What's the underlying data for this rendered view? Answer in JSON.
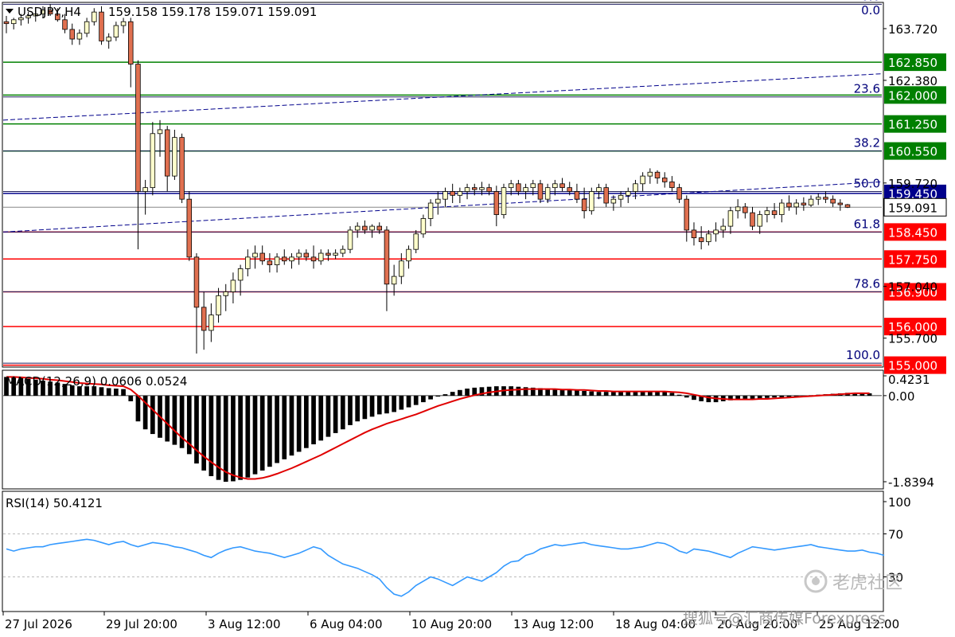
{
  "header": {
    "symbol_title": "USDJPY,H4",
    "ohlc": "159.158 159.178 159.071 159.091"
  },
  "colors": {
    "bull_candle": "#ffffcc",
    "bear_candle": "#e07050",
    "green_level": "#008000",
    "red_level": "#ff0000",
    "fib_line": "#1f1f5f",
    "trend_dash": "#00008b",
    "macd_signal": "#e00000",
    "rsi_line": "#3399ff"
  },
  "price_axis": {
    "ticks": [
      "163.720",
      "162.380",
      "159.720",
      "157.040",
      "155.700"
    ]
  },
  "levels": [
    {
      "price": 162.85,
      "label": "162.850",
      "color": "green"
    },
    {
      "price": 162.0,
      "label": "162.000",
      "color": "green"
    },
    {
      "price": 161.25,
      "label": "161.250",
      "color": "green"
    },
    {
      "price": 160.55,
      "label": "160.550",
      "color": "green"
    },
    {
      "price": 159.45,
      "label": "159.450",
      "color": "blue"
    },
    {
      "price": 158.45,
      "label": "158.450",
      "color": "red"
    },
    {
      "price": 157.75,
      "label": "157.750",
      "color": "red"
    },
    {
      "price": 156.9,
      "label": "156.900",
      "color": "red"
    },
    {
      "price": 156.0,
      "label": "156.000",
      "color": "red"
    },
    {
      "price": 155.0,
      "label": "155.000",
      "color": "red"
    }
  ],
  "fibonacci": [
    {
      "level": "0.0",
      "price": 164.35
    },
    {
      "level": "23.6",
      "price": 161.95
    },
    {
      "level": "38.2",
      "price": 160.55
    },
    {
      "level": "50.0",
      "price": 159.5
    },
    {
      "level": "61.8",
      "price": 158.45
    },
    {
      "level": "78.6",
      "price": 156.9
    },
    {
      "level": "100.0",
      "price": 155.05
    }
  ],
  "current_price": "159.091",
  "macd": {
    "label": "MACD(12,26,9) 0.0606 0.0524",
    "ticks": [
      "0.4231",
      "0.00",
      "-1.8394"
    ]
  },
  "rsi": {
    "label": "RSI(14) 50.4121",
    "ticks": [
      "100",
      "70",
      "30"
    ]
  },
  "time_axis": {
    "labels": [
      "27 Jul 2026",
      "29 Jul 20:00",
      "3 Aug 12:00",
      "6 Aug 04:00",
      "10 Aug 20:00",
      "13 Aug 12:00",
      "18 Aug 04:00",
      "20 Aug 20:00",
      "25 Aug 12:00"
    ]
  },
  "watermarks": {
    "top": "老虎社区",
    "bottom": "搜狐号@汇商传媒Forexpress"
  },
  "chart_data": {
    "type": "candlestick",
    "title": "USDJPY,H4",
    "ylim": [
      154.95,
      164.4
    ],
    "candles_ohlc": [
      [
        163.9,
        164.05,
        163.6,
        163.85
      ],
      [
        163.85,
        164.0,
        163.7,
        163.95
      ],
      [
        163.95,
        164.1,
        163.8,
        164.0
      ],
      [
        164.0,
        164.15,
        163.85,
        164.05
      ],
      [
        164.05,
        164.2,
        163.9,
        164.1
      ],
      [
        164.1,
        164.3,
        164.0,
        164.2
      ],
      [
        164.2,
        164.35,
        164.05,
        164.1
      ],
      [
        164.1,
        164.25,
        163.9,
        163.95
      ],
      [
        163.95,
        164.1,
        163.6,
        163.7
      ],
      [
        163.7,
        163.85,
        163.3,
        163.45
      ],
      [
        163.45,
        163.7,
        163.3,
        163.6
      ],
      [
        163.6,
        164.0,
        163.5,
        163.9
      ],
      [
        163.9,
        164.25,
        163.8,
        164.15
      ],
      [
        164.15,
        164.3,
        163.3,
        163.4
      ],
      [
        163.4,
        163.6,
        163.2,
        163.5
      ],
      [
        163.5,
        163.9,
        163.4,
        163.8
      ],
      [
        163.8,
        164.0,
        163.6,
        163.9
      ],
      [
        163.9,
        164.0,
        162.2,
        162.8
      ],
      [
        162.8,
        162.9,
        158.0,
        159.5
      ],
      [
        159.5,
        159.8,
        158.9,
        159.6
      ],
      [
        159.6,
        161.3,
        159.4,
        161.0
      ],
      [
        161.0,
        161.35,
        160.4,
        161.1
      ],
      [
        161.1,
        161.2,
        159.5,
        159.9
      ],
      [
        159.9,
        161.1,
        159.8,
        160.9
      ],
      [
        160.9,
        161.0,
        159.2,
        159.3
      ],
      [
        159.3,
        159.5,
        157.7,
        157.8
      ],
      [
        157.8,
        157.9,
        155.3,
        156.5
      ],
      [
        156.5,
        156.9,
        155.4,
        155.9
      ],
      [
        155.9,
        156.6,
        155.6,
        156.3
      ],
      [
        156.3,
        157.0,
        156.1,
        156.8
      ],
      [
        156.8,
        157.1,
        156.4,
        156.9
      ],
      [
        156.9,
        157.4,
        156.6,
        157.2
      ],
      [
        157.2,
        157.6,
        156.8,
        157.5
      ],
      [
        157.5,
        158.0,
        157.3,
        157.8
      ],
      [
        157.8,
        158.1,
        157.5,
        157.9
      ],
      [
        157.9,
        158.1,
        157.6,
        157.7
      ],
      [
        157.7,
        157.9,
        157.4,
        157.6
      ],
      [
        157.6,
        157.9,
        157.4,
        157.8
      ],
      [
        157.8,
        158.0,
        157.6,
        157.7
      ],
      [
        157.7,
        157.9,
        157.5,
        157.8
      ],
      [
        157.8,
        158.0,
        157.6,
        157.9
      ],
      [
        157.9,
        158.0,
        157.7,
        157.8
      ],
      [
        157.8,
        158.1,
        157.5,
        157.7
      ],
      [
        157.7,
        158.0,
        157.6,
        157.9
      ],
      [
        157.9,
        158.0,
        157.7,
        157.85
      ],
      [
        157.85,
        158.0,
        157.75,
        157.9
      ],
      [
        157.9,
        158.1,
        157.8,
        158.0
      ],
      [
        158.0,
        158.6,
        157.9,
        158.5
      ],
      [
        158.5,
        158.7,
        158.3,
        158.6
      ],
      [
        158.6,
        158.75,
        158.4,
        158.5
      ],
      [
        158.5,
        158.65,
        158.3,
        158.6
      ],
      [
        158.6,
        158.7,
        158.4,
        158.5
      ],
      [
        158.5,
        158.6,
        156.4,
        157.1
      ],
      [
        157.1,
        157.6,
        156.8,
        157.3
      ],
      [
        157.3,
        157.9,
        157.1,
        157.7
      ],
      [
        157.7,
        158.1,
        157.5,
        158.0
      ],
      [
        158.0,
        158.5,
        157.9,
        158.4
      ],
      [
        158.4,
        158.9,
        158.3,
        158.8
      ],
      [
        158.8,
        159.3,
        158.6,
        159.2
      ],
      [
        159.2,
        159.5,
        158.9,
        159.3
      ],
      [
        159.3,
        159.6,
        159.1,
        159.5
      ],
      [
        159.5,
        159.7,
        159.2,
        159.4
      ],
      [
        159.4,
        159.6,
        159.2,
        159.5
      ],
      [
        159.5,
        159.7,
        159.3,
        159.6
      ],
      [
        159.6,
        159.7,
        159.4,
        159.55
      ],
      [
        159.55,
        159.75,
        159.4,
        159.6
      ],
      [
        159.6,
        159.7,
        159.4,
        159.5
      ],
      [
        159.5,
        159.65,
        158.6,
        158.9
      ],
      [
        158.9,
        159.7,
        158.8,
        159.6
      ],
      [
        159.6,
        159.8,
        159.4,
        159.7
      ],
      [
        159.7,
        159.8,
        159.4,
        159.5
      ],
      [
        159.5,
        159.7,
        159.3,
        159.6
      ],
      [
        159.6,
        159.8,
        159.4,
        159.7
      ],
      [
        159.7,
        159.8,
        159.2,
        159.3
      ],
      [
        159.3,
        159.7,
        159.2,
        159.6
      ],
      [
        159.6,
        159.8,
        159.4,
        159.7
      ],
      [
        159.7,
        159.85,
        159.5,
        159.6
      ],
      [
        159.6,
        159.75,
        159.4,
        159.5
      ],
      [
        159.5,
        159.7,
        159.2,
        159.3
      ],
      [
        159.3,
        159.6,
        158.8,
        159.0
      ],
      [
        159.0,
        159.6,
        158.9,
        159.5
      ],
      [
        159.5,
        159.7,
        159.3,
        159.6
      ],
      [
        159.6,
        159.7,
        159.1,
        159.2
      ],
      [
        159.2,
        159.4,
        159.0,
        159.3
      ],
      [
        159.3,
        159.5,
        159.1,
        159.4
      ],
      [
        159.4,
        159.6,
        159.2,
        159.5
      ],
      [
        159.5,
        159.8,
        159.3,
        159.7
      ],
      [
        159.7,
        160.0,
        159.5,
        159.9
      ],
      [
        159.9,
        160.1,
        159.7,
        160.0
      ],
      [
        160.0,
        160.05,
        159.7,
        159.85
      ],
      [
        159.85,
        160.0,
        159.6,
        159.75
      ],
      [
        159.75,
        159.9,
        159.5,
        159.6
      ],
      [
        159.6,
        159.7,
        159.2,
        159.3
      ],
      [
        159.3,
        159.4,
        158.2,
        158.5
      ],
      [
        158.5,
        158.7,
        158.1,
        158.3
      ],
      [
        158.3,
        158.6,
        158.0,
        158.2
      ],
      [
        158.2,
        158.5,
        158.1,
        158.4
      ],
      [
        158.4,
        158.7,
        158.2,
        158.5
      ],
      [
        158.5,
        158.8,
        158.3,
        158.6
      ],
      [
        158.6,
        159.1,
        158.4,
        159.0
      ],
      [
        159.0,
        159.3,
        158.8,
        159.1
      ],
      [
        159.1,
        159.2,
        158.8,
        158.95
      ],
      [
        158.95,
        159.1,
        158.5,
        158.6
      ],
      [
        158.6,
        159.0,
        158.4,
        158.9
      ],
      [
        158.9,
        159.1,
        158.7,
        159.0
      ],
      [
        159.0,
        159.2,
        158.8,
        158.9
      ],
      [
        158.9,
        159.3,
        158.7,
        159.2
      ],
      [
        159.2,
        159.4,
        159.0,
        159.1
      ],
      [
        159.1,
        159.3,
        158.9,
        159.2
      ],
      [
        159.2,
        159.35,
        159.0,
        159.15
      ],
      [
        159.15,
        159.4,
        159.1,
        159.3
      ],
      [
        159.3,
        159.45,
        159.15,
        159.35
      ],
      [
        159.35,
        159.5,
        159.2,
        159.3
      ],
      [
        159.3,
        159.4,
        159.1,
        159.2
      ],
      [
        159.2,
        159.3,
        159.0,
        159.158
      ],
      [
        159.158,
        159.178,
        159.071,
        159.091
      ]
    ],
    "macd_hist": [
      0.4,
      0.4,
      0.38,
      0.36,
      0.34,
      0.32,
      0.3,
      0.28,
      0.25,
      0.22,
      0.2,
      0.2,
      0.2,
      0.18,
      0.16,
      0.15,
      0.14,
      -0.12,
      -0.55,
      -0.72,
      -0.82,
      -0.9,
      -0.98,
      -1.05,
      -1.12,
      -1.25,
      -1.45,
      -1.6,
      -1.72,
      -1.8,
      -1.84,
      -1.83,
      -1.8,
      -1.75,
      -1.68,
      -1.6,
      -1.52,
      -1.44,
      -1.36,
      -1.28,
      -1.2,
      -1.12,
      -1.04,
      -0.96,
      -0.88,
      -0.8,
      -0.72,
      -0.63,
      -0.55,
      -0.5,
      -0.45,
      -0.4,
      -0.38,
      -0.35,
      -0.3,
      -0.25,
      -0.2,
      -0.14,
      -0.08,
      -0.02,
      0.03,
      0.08,
      0.12,
      0.15,
      0.17,
      0.18,
      0.19,
      0.2,
      0.2,
      0.2,
      0.19,
      0.18,
      0.17,
      0.16,
      0.15,
      0.14,
      0.13,
      0.12,
      0.11,
      0.1,
      0.09,
      0.08,
      0.08,
      0.08,
      0.08,
      0.09,
      0.1,
      0.1,
      0.1,
      0.09,
      0.08,
      0.06,
      0.02,
      -0.04,
      -0.09,
      -0.12,
      -0.14,
      -0.14,
      -0.12,
      -0.1,
      -0.08,
      -0.07,
      -0.07,
      -0.06,
      -0.05,
      -0.04,
      -0.04,
      -0.03,
      -0.02,
      -0.01,
      0.01,
      0.02,
      0.03,
      0.04,
      0.05,
      0.06,
      0.06,
      0.05,
      0.05
    ],
    "macd_signal": [
      0.4,
      0.4,
      0.39,
      0.38,
      0.37,
      0.36,
      0.34,
      0.33,
      0.31,
      0.29,
      0.27,
      0.26,
      0.25,
      0.24,
      0.22,
      0.21,
      0.2,
      0.13,
      0.0,
      -0.15,
      -0.3,
      -0.45,
      -0.6,
      -0.75,
      -0.9,
      -1.03,
      -1.17,
      -1.3,
      -1.42,
      -1.53,
      -1.63,
      -1.7,
      -1.75,
      -1.78,
      -1.78,
      -1.76,
      -1.72,
      -1.67,
      -1.61,
      -1.55,
      -1.48,
      -1.41,
      -1.34,
      -1.27,
      -1.19,
      -1.11,
      -1.03,
      -0.95,
      -0.87,
      -0.79,
      -0.72,
      -0.66,
      -0.6,
      -0.55,
      -0.5,
      -0.45,
      -0.4,
      -0.34,
      -0.28,
      -0.22,
      -0.17,
      -0.12,
      -0.07,
      -0.03,
      0.01,
      0.04,
      0.07,
      0.09,
      0.11,
      0.12,
      0.13,
      0.14,
      0.14,
      0.14,
      0.14,
      0.14,
      0.13,
      0.13,
      0.12,
      0.12,
      0.11,
      0.1,
      0.1,
      0.09,
      0.09,
      0.09,
      0.09,
      0.09,
      0.09,
      0.09,
      0.09,
      0.08,
      0.07,
      0.05,
      0.02,
      -0.01,
      -0.04,
      -0.06,
      -0.07,
      -0.08,
      -0.08,
      -0.08,
      -0.08,
      -0.07,
      -0.07,
      -0.06,
      -0.05,
      -0.04,
      -0.03,
      -0.02,
      -0.01,
      0.0,
      0.01,
      0.02,
      0.03,
      0.04,
      0.05,
      0.05,
      0.05
    ],
    "rsi": [
      56,
      54,
      56,
      57,
      58,
      58,
      60,
      61,
      62,
      63,
      64,
      65,
      64,
      62,
      60,
      62,
      63,
      60,
      58,
      60,
      62,
      61,
      60,
      58,
      57,
      55,
      53,
      50,
      48,
      52,
      55,
      57,
      58,
      56,
      54,
      53,
      52,
      50,
      48,
      50,
      52,
      55,
      58,
      56,
      50,
      46,
      42,
      40,
      38,
      35,
      32,
      28,
      20,
      14,
      12,
      16,
      22,
      26,
      30,
      28,
      25,
      22,
      26,
      30,
      28,
      26,
      30,
      34,
      40,
      44,
      45,
      50,
      52,
      56,
      58,
      60,
      59,
      60,
      61,
      62,
      60,
      59,
      58,
      57,
      56,
      56,
      57,
      58,
      60,
      62,
      61,
      58,
      54,
      52,
      56,
      55,
      54,
      52,
      50,
      48,
      52,
      55,
      58,
      57,
      56,
      55,
      56,
      57,
      58,
      59,
      60,
      58,
      57,
      56,
      55,
      54,
      54,
      55,
      53,
      52,
      50
    ]
  }
}
